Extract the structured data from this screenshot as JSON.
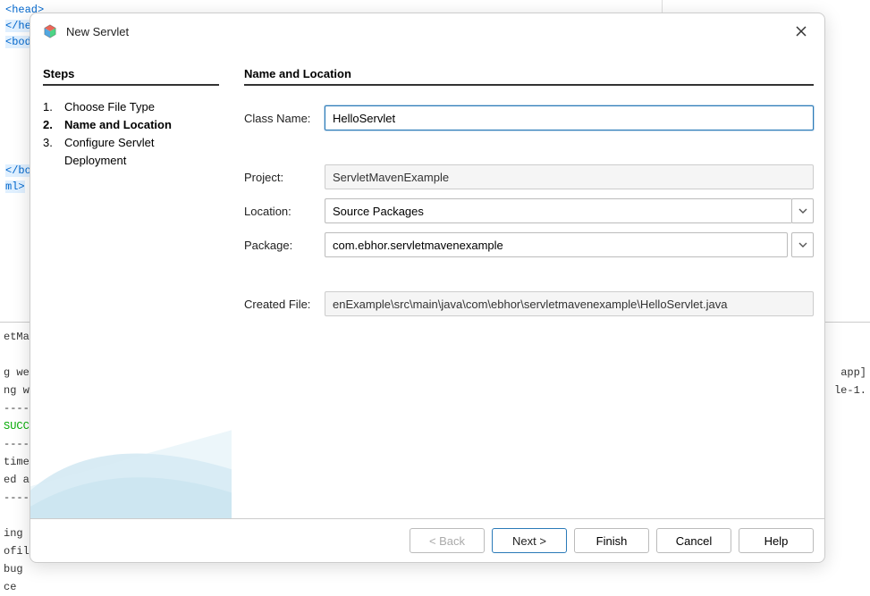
{
  "background": {
    "code_lines": [
      {
        "text": "<head>",
        "cls": "blue"
      },
      {
        "text": "</he",
        "cls": "blue hl"
      },
      {
        "text": "<bod",
        "cls": "blue hl"
      },
      {
        "text": "",
        "cls": ""
      },
      {
        "text": "",
        "cls": ""
      },
      {
        "text": "",
        "cls": ""
      },
      {
        "text": "",
        "cls": ""
      },
      {
        "text": "",
        "cls": ""
      },
      {
        "text": "",
        "cls": ""
      },
      {
        "text": "",
        "cls": ""
      },
      {
        "text": "</bo",
        "cls": "blue hl"
      },
      {
        "text": "ml>",
        "cls": "blue hl"
      }
    ],
    "output_left": [
      "etMa",
      "",
      "g we",
      "ng w",
      "----",
      "SUCC",
      "----",
      "time",
      "ed a",
      "----",
      "",
      "ing ",
      "ofil",
      "bug ",
      "ce "
    ],
    "output_right": [
      "app]",
      "le-1."
    ]
  },
  "dialog": {
    "title": "New Servlet",
    "steps_heading": "Steps",
    "steps": [
      {
        "num": "1.",
        "label": "Choose File Type",
        "current": false
      },
      {
        "num": "2.",
        "label": "Name and Location",
        "current": true
      },
      {
        "num": "3.",
        "label": "Configure Servlet Deployment",
        "current": false
      }
    ],
    "main_heading": "Name and Location",
    "fields": {
      "class_name_label": "Class Name:",
      "class_name_value": "HelloServlet",
      "project_label": "Project:",
      "project_value": "ServletMavenExample",
      "location_label": "Location:",
      "location_value": "Source Packages",
      "package_label": "Package:",
      "package_value": "com.ebhor.servletmavenexample",
      "created_file_label": "Created File:",
      "created_file_value": "enExample\\src\\main\\java\\com\\ebhor\\servletmavenexample\\HelloServlet.java"
    },
    "buttons": {
      "back": "< Back",
      "next": "Next >",
      "finish": "Finish",
      "cancel": "Cancel",
      "help": "Help"
    }
  }
}
